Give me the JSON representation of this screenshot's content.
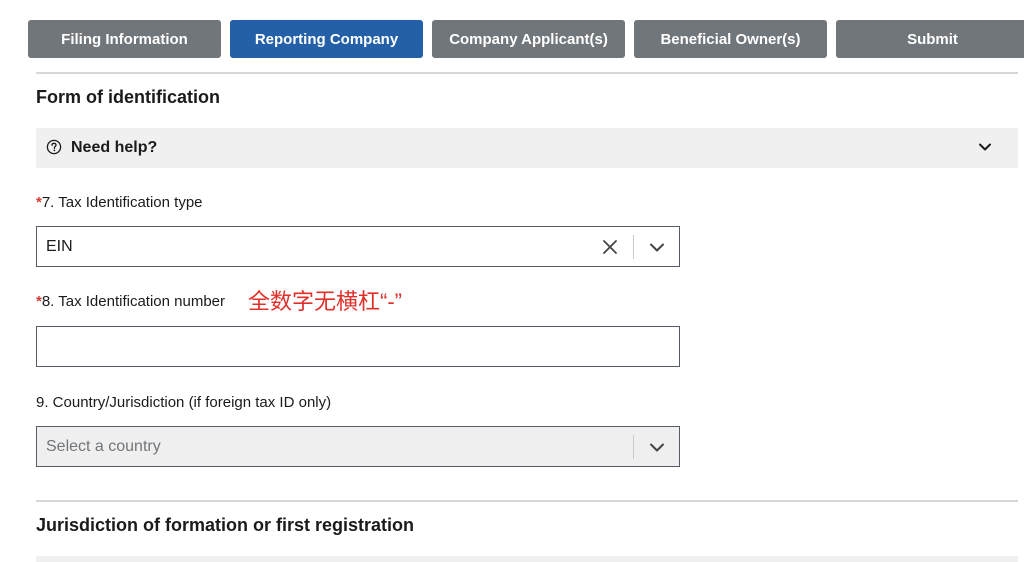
{
  "tabs": [
    {
      "label": "Filing Information",
      "active": false
    },
    {
      "label": "Reporting Company",
      "active": true
    },
    {
      "label": "Company Applicant(s)",
      "active": false
    },
    {
      "label": "Beneficial Owner(s)",
      "active": false
    },
    {
      "label": "Submit",
      "active": false
    }
  ],
  "section_form_id": {
    "title": "Form of identification"
  },
  "help": {
    "label": "Need help?"
  },
  "field7": {
    "required_mark": "*",
    "label": "7. Tax Identification type",
    "value": "EIN"
  },
  "field8": {
    "required_mark": "*",
    "label": "8. Tax Identification number",
    "value": ""
  },
  "annotation": {
    "text": "全数字无横杠“-”"
  },
  "field9": {
    "label": "9. Country/Jurisdiction (if foreign tax ID only)",
    "placeholder": "Select a country"
  },
  "section_jurisdiction": {
    "title": "Jurisdiction of formation or first registration"
  },
  "colors": {
    "tab_default": "#71767a",
    "tab_active": "#2360a8",
    "required": "#d83933",
    "annotation": "#e0302a"
  },
  "icons": {
    "help": "question-circle-icon",
    "close": "close-icon",
    "chevron": "chevron-down-icon"
  }
}
